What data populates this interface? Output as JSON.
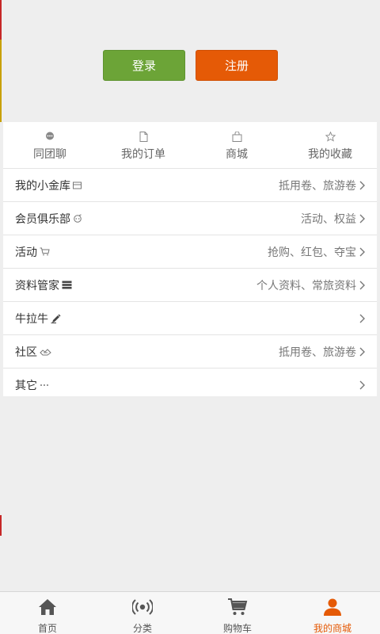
{
  "colors": {
    "login": "#6ca437",
    "register": "#e55a06",
    "active_tab": "#e55a06",
    "background": "#eeeeee"
  },
  "auth": {
    "login_label": "登录",
    "register_label": "注册"
  },
  "quick_links": [
    {
      "label": "同团聊",
      "icon": "chat-bubble-icon"
    },
    {
      "label": "我的订单",
      "icon": "document-icon"
    },
    {
      "label": "商城",
      "icon": "shopping-bag-icon"
    },
    {
      "label": "我的收藏",
      "icon": "star-icon"
    }
  ],
  "menu": [
    {
      "label": "我的小金库",
      "icon": "wallet-icon",
      "detail": "抵用卷、旅游卷"
    },
    {
      "label": "会员俱乐部",
      "icon": "club-icon",
      "detail": "活动、权益"
    },
    {
      "label": "活动",
      "icon": "cart-icon",
      "detail": "抢购、红包、夺宝"
    },
    {
      "label": "资料管家",
      "icon": "list-icon",
      "detail": "个人资料、常旅资料"
    },
    {
      "label": "牛拉牛",
      "icon": "pen-icon",
      "detail": ""
    },
    {
      "label": "社区",
      "icon": "community-icon",
      "detail": "抵用卷、旅游卷"
    },
    {
      "label": "其它",
      "icon": "ellipsis-icon",
      "detail": ""
    }
  ],
  "tabs": [
    {
      "label": "首页",
      "icon": "home-icon",
      "active": false
    },
    {
      "label": "分类",
      "icon": "broadcast-icon",
      "active": false
    },
    {
      "label": "购物车",
      "icon": "shopping-cart-icon",
      "active": false
    },
    {
      "label": "我的商城",
      "icon": "user-icon",
      "active": true
    }
  ]
}
